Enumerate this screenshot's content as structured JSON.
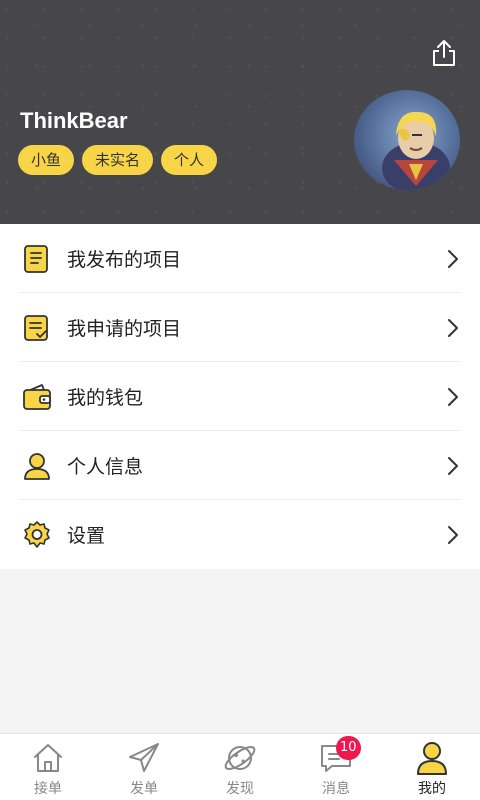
{
  "profile": {
    "username": "ThinkBear",
    "tags": [
      "小鱼",
      "未实名",
      "个人"
    ]
  },
  "menu": {
    "items": [
      {
        "label": "我发布的项目",
        "icon": "published-projects-icon"
      },
      {
        "label": "我申请的项目",
        "icon": "applied-projects-icon"
      },
      {
        "label": "我的钱包",
        "icon": "wallet-icon"
      },
      {
        "label": "个人信息",
        "icon": "person-icon"
      },
      {
        "label": "设置",
        "icon": "settings-gear-icon"
      }
    ]
  },
  "tabbar": {
    "tabs": [
      {
        "label": "接单",
        "icon": "home-icon"
      },
      {
        "label": "发单",
        "icon": "paper-plane-icon"
      },
      {
        "label": "发现",
        "icon": "planet-icon"
      },
      {
        "label": "消息",
        "icon": "message-icon",
        "badge": "10"
      },
      {
        "label": "我的",
        "icon": "profile-icon",
        "active": true
      }
    ]
  },
  "colors": {
    "accent": "#f7d547",
    "header_bg": "#47464b",
    "badge": "#f0164e"
  }
}
